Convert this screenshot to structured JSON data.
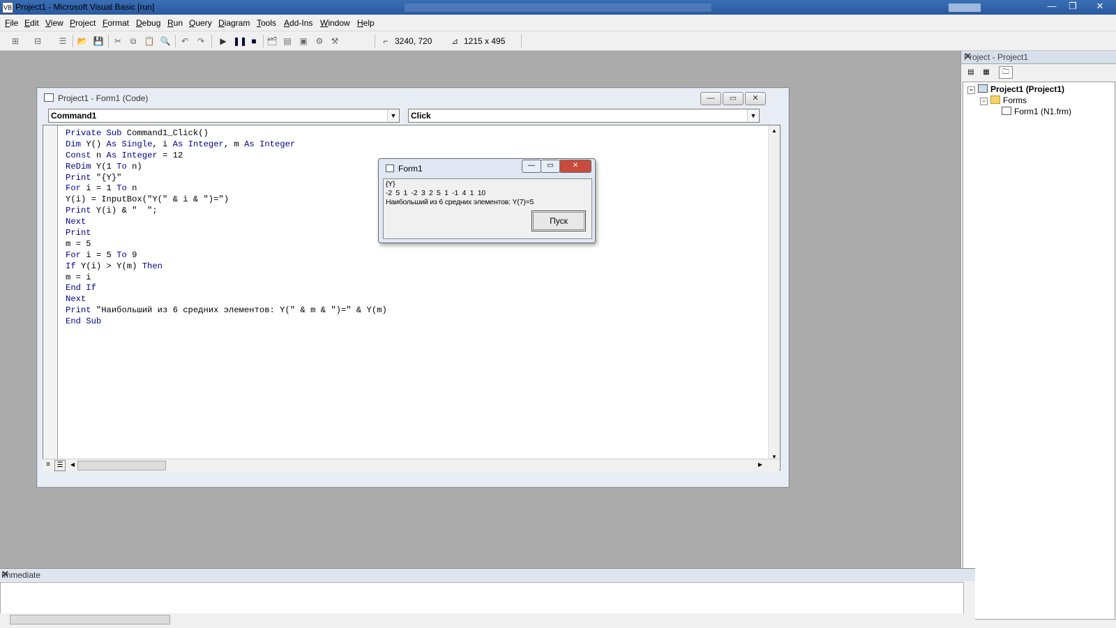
{
  "window": {
    "title": "Project1 - Microsoft Visual Basic [run]",
    "minimize": "—",
    "restore": "❐",
    "close": "✕"
  },
  "menu": [
    {
      "label": "File"
    },
    {
      "label": "Edit"
    },
    {
      "label": "View"
    },
    {
      "label": "Project"
    },
    {
      "label": "Format"
    },
    {
      "label": "Debug"
    },
    {
      "label": "Run"
    },
    {
      "label": "Query"
    },
    {
      "label": "Diagram"
    },
    {
      "label": "Tools"
    },
    {
      "label": "Add-Ins"
    },
    {
      "label": "Window"
    },
    {
      "label": "Help"
    }
  ],
  "toolbar": {
    "position_readout": "3240, 720",
    "size_readout": "1215 x 495"
  },
  "code_window": {
    "title": "Project1 - Form1 (Code)",
    "object_combo": "Command1",
    "procedure_combo": "Click",
    "lines": [
      "Private Sub Command1_Click()",
      "Dim Y() As Single, i As Integer, m As Integer",
      "Const n As Integer = 12",
      "ReDim Y(1 To n)",
      "Print \"{Y}\"",
      "For i = 1 To n",
      "Y(i) = InputBox(\"Y(\" & i & \")=\")",
      "Print Y(i) & \"  \";",
      "Next",
      "Print",
      "m = 5",
      "For i = 5 To 9",
      "If Y(i) > Y(m) Then",
      "m = i",
      "End If",
      "Next",
      "Print \"Наибольший из 6 средних элементов: Y(\" & m & \")=\" & Y(m)",
      "End Sub"
    ]
  },
  "form1": {
    "title": "Form1",
    "output": [
      "{Y}",
      "-2  5  1  -2  3  2  5  1  -1  4  1  10",
      "Наибольший из 6 средних элементов: Y(7)=5"
    ],
    "button": "Пуск"
  },
  "project_pane": {
    "header": "Project - Project1",
    "tree": {
      "project": "Project1 (Project1)",
      "folder": "Forms",
      "form": "Form1 (N1.frm)"
    }
  },
  "immediate": {
    "header": "Immediate"
  }
}
